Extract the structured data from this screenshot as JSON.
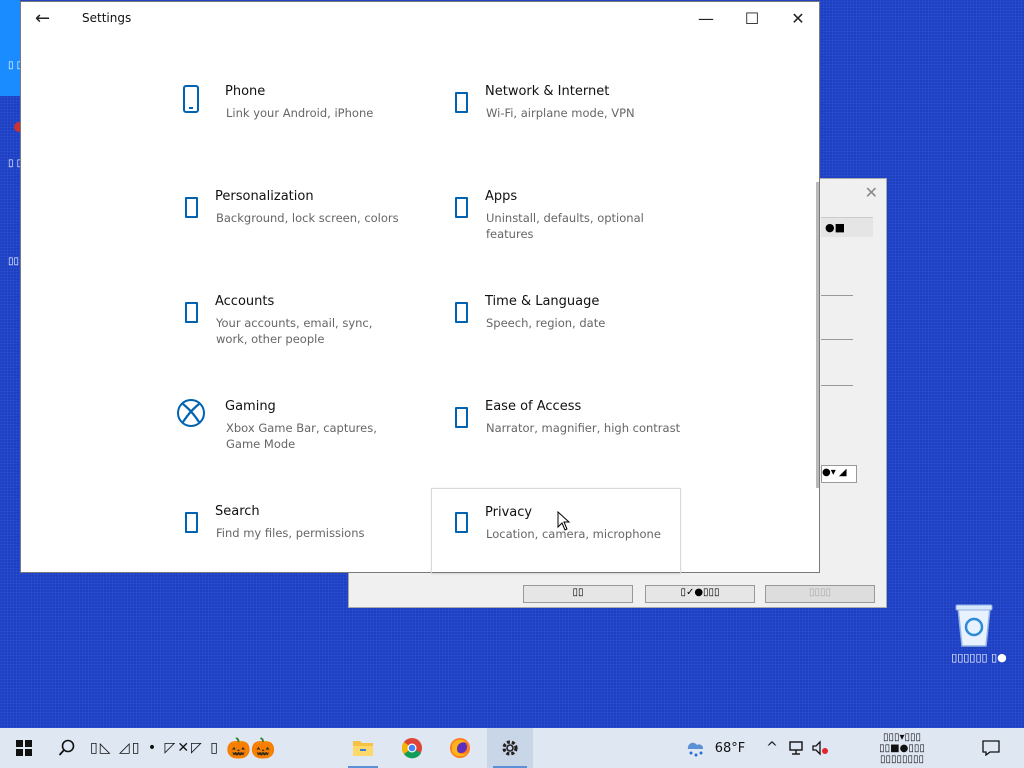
{
  "window": {
    "title": "Settings",
    "controls": {
      "minimize": "—",
      "maximize": "☐",
      "close": "✕"
    },
    "back": "←"
  },
  "tiles": [
    {
      "title": "Phone",
      "subtitle": "Link your Android, iPhone",
      "icon": "phone-icon"
    },
    {
      "title": "Network & Internet",
      "subtitle": "Wi-Fi, airplane mode, VPN",
      "icon": "network-icon"
    },
    {
      "title": "Personalization",
      "subtitle": "Background, lock screen, colors",
      "icon": "personalization-icon"
    },
    {
      "title": "Apps",
      "subtitle": "Uninstall, defaults, optional features",
      "icon": "apps-icon"
    },
    {
      "title": "Accounts",
      "subtitle": "Your accounts, email, sync, work, other people",
      "icon": "accounts-icon"
    },
    {
      "title": "Time & Language",
      "subtitle": "Speech, region, date",
      "icon": "time-language-icon"
    },
    {
      "title": "Gaming",
      "subtitle": "Xbox Game Bar, captures, Game Mode",
      "icon": "xbox-icon"
    },
    {
      "title": "Ease of Access",
      "subtitle": "Narrator, magnifier, high contrast",
      "icon": "ease-of-access-icon"
    },
    {
      "title": "Search",
      "subtitle": "Find my files, permissions",
      "icon": "search-icon"
    },
    {
      "title": "Privacy",
      "subtitle": "Location, camera, microphone",
      "icon": "privacy-icon"
    }
  ],
  "background_dialog": {
    "close": "✕",
    "header_text": "●■",
    "combo_text": "●▾ ◢",
    "buttons": [
      "▯▯",
      "▯✓●▯▯▯",
      "▯▯▯▯"
    ]
  },
  "desktop": {
    "recycle_bin_label": "▯▯▯▯▯▯ ▯●"
  },
  "taskbar": {
    "weather_temp": "68°F",
    "clock_line1": "▯▯▯▾▯▯▯",
    "clock_line2": "▯▯■●▯▯▯",
    "clock_line3": "▯▯▯▯▯▯▯▯"
  },
  "colors": {
    "accent": "#0063b1",
    "desktop": "#1e3fbf",
    "taskbar": "#dfe7f3"
  }
}
